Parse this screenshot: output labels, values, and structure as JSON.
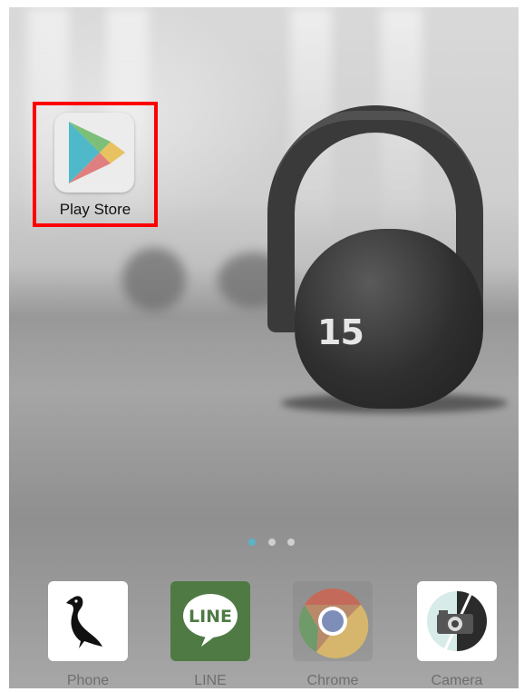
{
  "home": {
    "highlighted_app": {
      "label": "Play Store",
      "icon": "play-store-icon",
      "highlight_color": "#ff0000"
    },
    "wallpaper": {
      "kettlebell_weight": "15"
    },
    "page_indicator": {
      "pages": 3,
      "active_index": 0,
      "active_color": "#5ab4c7"
    }
  },
  "dock": {
    "apps": [
      {
        "label": "Phone",
        "icon": "phone-bird-icon"
      },
      {
        "label": "LINE",
        "icon": "line-icon",
        "icon_text": "LINE",
        "color": "#4f7a44"
      },
      {
        "label": "Chrome",
        "icon": "chrome-icon"
      },
      {
        "label": "Camera",
        "icon": "camera-icon"
      }
    ]
  }
}
